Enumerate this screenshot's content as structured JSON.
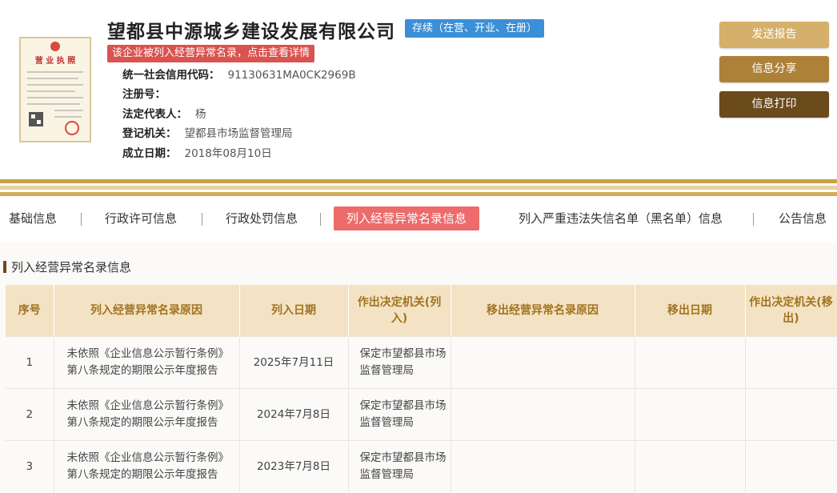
{
  "company": {
    "name": "望都县中源城乡建设发展有限公司",
    "status": "存续（在营、开业、在册）",
    "alert": "该企业被列入经营异常名录，点击查看详情",
    "license_image_title": "营 业 执 照"
  },
  "info": {
    "credit_code_label": "统一社会信用代码：",
    "credit_code": "91130631MA0CK2969B",
    "reg_no_label": "注册号：",
    "reg_no": "",
    "legal_rep_label": "法定代表人：",
    "legal_rep": "杨",
    "authority_label": "登记机关：",
    "authority": "望都县市场监督管理局",
    "established_label": "成立日期：",
    "established": "2018年08月10日"
  },
  "actions": {
    "send_report": "发送报告",
    "share": "信息分享",
    "print": "信息打印"
  },
  "colors": {
    "send_report": "#d4b06a",
    "share": "#ad8238",
    "print": "#6b4a1c",
    "status_badge": "#3b8fd6",
    "alert": "#d9534f",
    "active_tab": "#ed6b6b"
  },
  "tabs": [
    {
      "label": "基础信息"
    },
    {
      "label": "行政许可信息"
    },
    {
      "label": "行政处罚信息"
    },
    {
      "label": "列入经营异常名录信息",
      "active": true
    },
    {
      "label": "列入严重违法失信名单（黑名单）信息"
    },
    {
      "label": "公告信息"
    }
  ],
  "section": {
    "title": "列入经营异常名录信息"
  },
  "table": {
    "headers": [
      "序号",
      "列入经营异常名录原因",
      "列入日期",
      "作出决定机关(列入)",
      "移出经营异常名录原因",
      "移出日期",
      "作出决定机关(移出)"
    ],
    "rows": [
      {
        "no": "1",
        "reason": "未依照《企业信息公示暂行条例》第八条规定的期限公示年度报告",
        "date": "2025年7月11日",
        "authority": "保定市望都县市场监督管理局",
        "remove_reason": "",
        "remove_date": "",
        "remove_authority": ""
      },
      {
        "no": "2",
        "reason": "未依照《企业信息公示暂行条例》第八条规定的期限公示年度报告",
        "date": "2024年7月8日",
        "authority": "保定市望都县市场监督管理局",
        "remove_reason": "",
        "remove_date": "",
        "remove_authority": ""
      },
      {
        "no": "3",
        "reason": "未依照《企业信息公示暂行条例》第八条规定的期限公示年度报告",
        "date": "2023年7月8日",
        "authority": "保定市望都县市场监督管理局",
        "remove_reason": "",
        "remove_date": "",
        "remove_authority": ""
      }
    ]
  }
}
